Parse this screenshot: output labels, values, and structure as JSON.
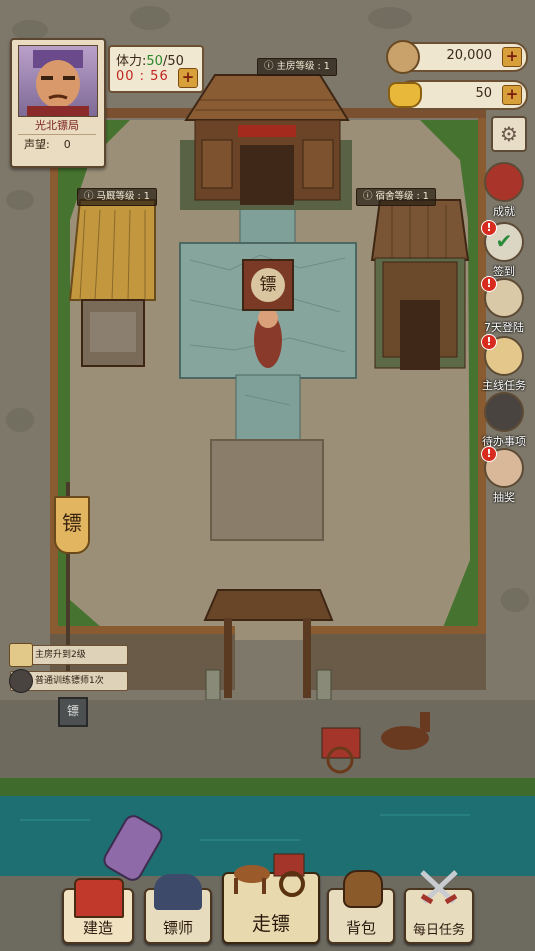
{
  "player": {
    "name": "光北镖局",
    "reputation_label": "声望:",
    "reputation_value": "0"
  },
  "stamina": {
    "label": "体力:",
    "current": "50",
    "max": "/50",
    "timer": "00 : 56"
  },
  "resources": {
    "coins": "20,000",
    "gold": "50"
  },
  "buildings": {
    "main_house": "主房等级 : 1",
    "stable": "马厩等级 : 1",
    "dorm": "宿舍等级 : 1",
    "banner_char": "镖",
    "sign_char": "镖"
  },
  "side_menu": [
    {
      "label": "成就",
      "icon": "achievement-icon",
      "badge": ""
    },
    {
      "label": "签到",
      "icon": "checkin-icon",
      "badge": "!"
    },
    {
      "label": "7天登陆",
      "icon": "seven-day-login-icon",
      "badge": "!"
    },
    {
      "label": "主线任务",
      "icon": "main-quest-icon",
      "badge": "!"
    },
    {
      "label": "待办事项",
      "icon": "todo-icon",
      "badge": ""
    },
    {
      "label": "抽奖",
      "icon": "lottery-icon",
      "badge": "!"
    }
  ],
  "notes": [
    {
      "text": "主房升到2级",
      "icon": "scroll-icon"
    },
    {
      "text": "普通训练镖师1次",
      "icon": "helmet-icon"
    }
  ],
  "nav": {
    "build": "建造",
    "escort_master": "镖师",
    "go_escort": "走镖",
    "backpack": "背包",
    "daily": "每日任务"
  },
  "colors": {
    "dirt": "#9a8d77",
    "wall": "#5a4a3a",
    "water": "#1d6f71",
    "grass": "#3f6b2d",
    "stone": "#7fa098"
  }
}
